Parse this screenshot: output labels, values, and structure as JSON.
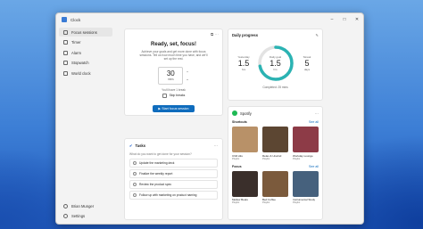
{
  "app": {
    "title": "Clock",
    "controls": [
      "–",
      "□",
      "✕"
    ]
  },
  "sidebar": {
    "items": [
      {
        "label": "Focus sessions",
        "active": true
      },
      {
        "label": "Timer",
        "active": false
      },
      {
        "label": "Alarm",
        "active": false
      },
      {
        "label": "Stopwatch",
        "active": false
      },
      {
        "label": "World clock",
        "active": false
      }
    ],
    "account": "Brian Munger",
    "settings": "Settings"
  },
  "focus": {
    "heading": "Ready, set, focus!",
    "description": "Achieve your goals and get more done with focus sessions. Tell us how much time you have, and we'll set up the rest.",
    "minutes": "30",
    "unit": "mins",
    "note": "You'll have 1 break",
    "skip_label": "Skip breaks",
    "start_label": "Start focus session"
  },
  "tasks": {
    "title": "Tasks",
    "prompt": "What do you want to get done for your session?",
    "items": [
      "Update the marketing deck",
      "Finalize the weekly report",
      "Review the product spec",
      "Follow up with marketing on product naming"
    ]
  },
  "daily": {
    "title": "Daily progress",
    "yesterday": {
      "label": "Yesterday",
      "value": "1.5",
      "unit": "hrs"
    },
    "goal": {
      "label": "Daily goal",
      "value": "1.5",
      "unit": "hrs",
      "progress": 0.72
    },
    "streak": {
      "label": "Streak",
      "value": "5",
      "unit": "days"
    },
    "completed": "Completed: 25 mins"
  },
  "spotify": {
    "title": "Spotify",
    "sections": [
      {
        "title": "Shortcuts",
        "see_all": "See all",
        "albums": [
          {
            "title": "Chill Hits",
            "subtitle": "Playlist",
            "color": "#b89168"
          },
          {
            "title": "Relax & Unwind",
            "subtitle": "Playlist",
            "color": "#5c4632"
          },
          {
            "title": "Workday Lounge",
            "subtitle": "Playlist",
            "color": "#8d3b47"
          }
        ]
      },
      {
        "title": "Focus",
        "see_all": "See all",
        "albums": [
          {
            "title": "Mellow Beats",
            "subtitle": "Playlist",
            "color": "#3a2f2b"
          },
          {
            "title": "Bed Coffee",
            "subtitle": "Playlist",
            "color": "#7b5a3c"
          },
          {
            "title": "Instrumental Study",
            "subtitle": "Playlist",
            "color": "#46617d"
          }
        ]
      }
    ]
  },
  "colors": {
    "accent": "#0f6cbd",
    "ring": "#2bb3b3",
    "spotify": "#1db954"
  }
}
